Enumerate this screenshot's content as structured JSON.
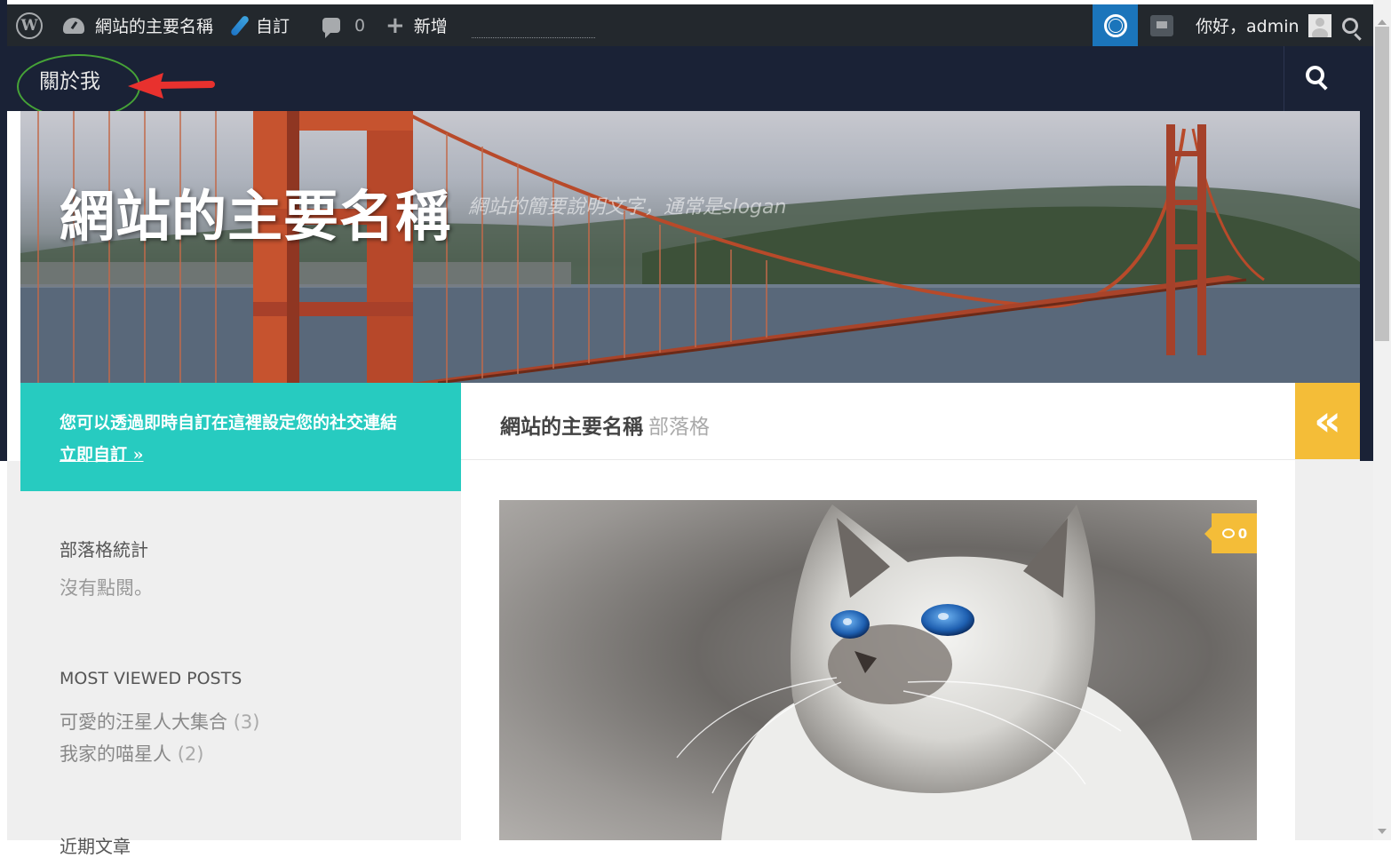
{
  "admin_bar": {
    "site_name": "網站的主要名稱",
    "customize": "自訂",
    "comments_count": "0",
    "new_label": "新增",
    "greeting": "你好，admin",
    "icons": [
      "wordpress-logo",
      "dashboard-icon",
      "brush-icon",
      "comment-icon",
      "plus-icon",
      "help-lifebuoy-icon",
      "notice-icon",
      "avatar",
      "search-icon"
    ]
  },
  "nav": {
    "about": "關於我",
    "search_icon": "search-icon"
  },
  "hero": {
    "title": "網站的主要名稱",
    "tagline": "網站的簡要說明文字，通常是slogan"
  },
  "sidebar": {
    "social_notice": "您可以透過即時自訂在這裡設定您的社交連結",
    "social_link": "立即自訂 »",
    "widgets": {
      "stats_title": "部落格統計",
      "stats_text": "沒有點閱。",
      "popular_title": "MOST VIEWED POSTS",
      "popular_posts": [
        {
          "title": "可愛的汪星人大集合",
          "count": "(3)"
        },
        {
          "title": "我家的喵星人",
          "count": "(2)"
        }
      ],
      "next_title_partial": "近期文章"
    }
  },
  "main": {
    "breadcrumb_name": "網站的主要名稱",
    "breadcrumb_blog": "部落格",
    "post": {
      "comment_count": "0",
      "image_alt": "cat-photo"
    }
  },
  "collapse": {
    "label": "«"
  },
  "colors": {
    "admin_bar": "#23282d",
    "nav": "#1a2236",
    "teal": "#27cbc0",
    "yellow": "#f4bd38",
    "help_blue": "#1b75bb",
    "annotation_green": "#46a337",
    "annotation_red": "#e8312e"
  }
}
